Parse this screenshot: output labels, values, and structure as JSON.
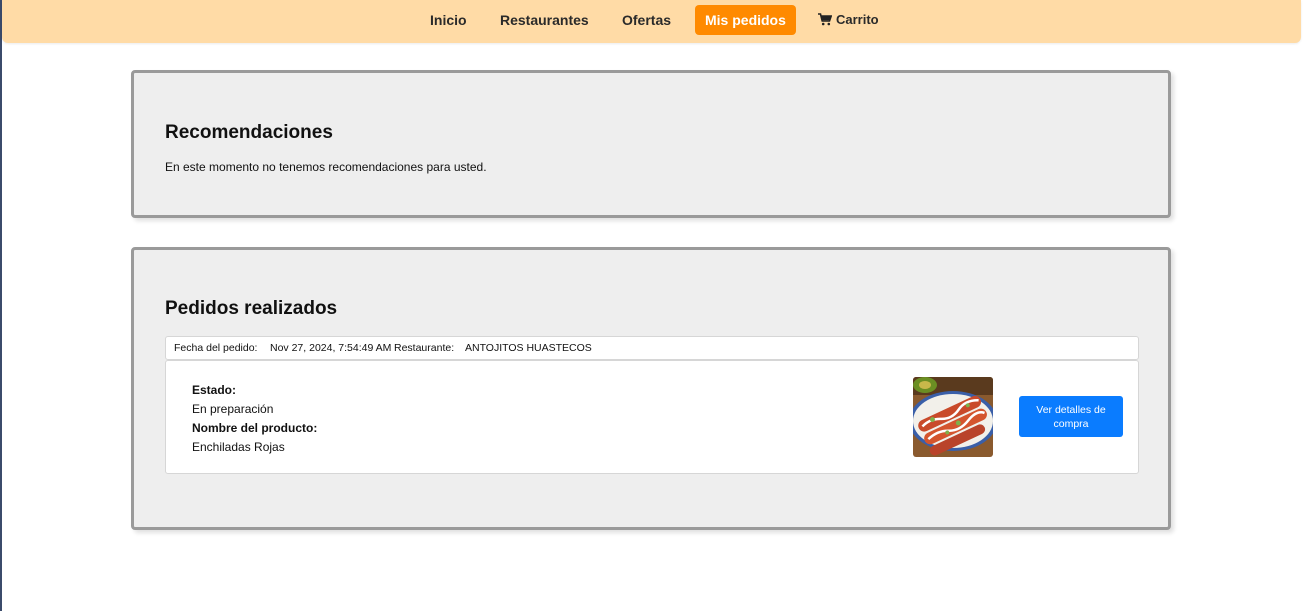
{
  "nav": {
    "items": [
      {
        "label": "Inicio"
      },
      {
        "label": "Restaurantes"
      },
      {
        "label": "Ofertas"
      },
      {
        "label": "Mis pedidos",
        "active": true
      },
      {
        "label": "Carrito",
        "icon": "cart-icon"
      }
    ]
  },
  "recommendations": {
    "title": "Recomendaciones",
    "message": "En este momento no tenemos recomendaciones para usted."
  },
  "orders": {
    "title": "Pedidos realizados",
    "items": [
      {
        "date_label": "Fecha del pedido:",
        "date_value": "Nov 27, 2024, 7:54:49 AM",
        "restaurant_label": "Restaurante:",
        "restaurant_value": "ANTOJITOS HUASTECOS",
        "status_label": "Estado:",
        "status_value": "En preparación",
        "product_label": "Nombre del producto:",
        "product_value": "Enchiladas Rojas",
        "product_image": "enchiladas-photo",
        "details_button": "Ver detalles de compra"
      }
    ]
  },
  "colors": {
    "nav_bg": "#ffdba6",
    "nav_active": "#ff8a00",
    "panel_bg": "#eeeeee",
    "button": "#0a7cff"
  }
}
